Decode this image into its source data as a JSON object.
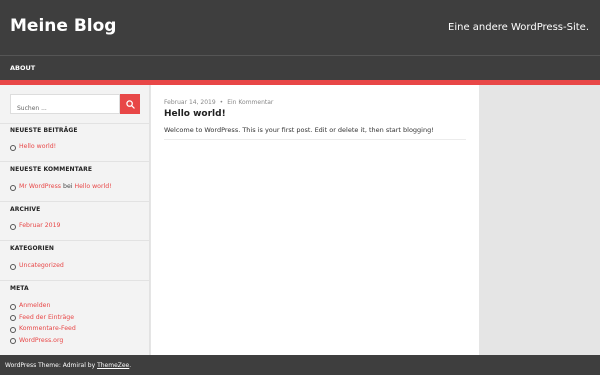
{
  "header": {
    "site_title": "Meine Blog",
    "site_description": "Eine andere WordPress-Site."
  },
  "nav": {
    "items": [
      {
        "label": "ABOUT"
      }
    ]
  },
  "colors": {
    "accent": "#e84747",
    "header_bg": "#3e3e3e",
    "sidebar_bg": "#f3f3f3",
    "page_bg": "#e5e5e5"
  },
  "sidebar": {
    "search": {
      "placeholder": "Suchen ...",
      "button_icon": "search-icon"
    },
    "recent_posts": {
      "title": "NEUESTE BEITRÄGE",
      "items": [
        "Hello world!"
      ]
    },
    "recent_comments": {
      "title": "NEUESTE KOMMENTARE",
      "items": [
        {
          "author": "Mr WordPress",
          "connector": "bei",
          "post": "Hello world!"
        }
      ]
    },
    "archives": {
      "title": "ARCHIVE",
      "items": [
        "Februar 2019"
      ]
    },
    "categories": {
      "title": "KATEGORIEN",
      "items": [
        "Uncategorized"
      ]
    },
    "meta": {
      "title": "META",
      "items": [
        "Anmelden",
        "Feed der Einträge",
        "Kommentare-Feed",
        "WordPress.org"
      ]
    }
  },
  "post": {
    "date": "Februar 14, 2019",
    "separator": "•",
    "comments_link": "Ein Kommentar",
    "title": "Hello world!",
    "body": "Welcome to WordPress. This is your first post. Edit or delete it, then start blogging!"
  },
  "footer": {
    "prefix": "WordPress Theme: Admiral by",
    "link": "ThemeZee",
    "suffix": "."
  }
}
